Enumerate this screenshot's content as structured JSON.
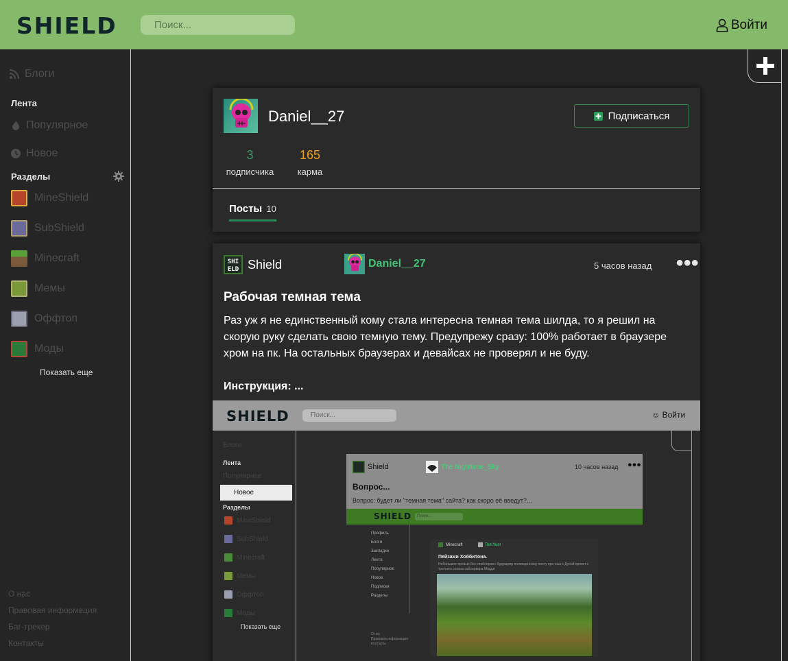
{
  "header": {
    "logo": "SHIELD",
    "search_placeholder": "Поиск...",
    "login_label": "Войти"
  },
  "sidebar": {
    "blogs": "Блоги",
    "feed_heading": "Лента",
    "popular": "Популярное",
    "new": "Новое",
    "sections_heading": "Разделы",
    "sections": [
      {
        "label": "MineShield",
        "color": "#b5442a"
      },
      {
        "label": "SubShield",
        "color": "#6a6a9a"
      },
      {
        "label": "Minecraft",
        "color": "#4a8a3a"
      },
      {
        "label": "Мемы",
        "color": "#7a9a3a"
      },
      {
        "label": "Оффтоп",
        "color": "#9aa0b0"
      },
      {
        "label": "Моды",
        "color": "#2a7a3a"
      }
    ],
    "show_more": "Показать еще",
    "footer": [
      "О нас",
      "Правовая информация",
      "Баг-трекер",
      "Контакты"
    ]
  },
  "profile": {
    "username": "Daniel__27",
    "subscribe_label": "Подписаться",
    "subscribers_count": "3",
    "subscribers_label": "подписчика",
    "karma_count": "165",
    "karma_label": "карма",
    "tab_label": "Посты",
    "tab_count": "10"
  },
  "post": {
    "source": "Shield",
    "author": "Daniel__27",
    "time": "5 часов назад",
    "title": "Рабочая темная тема",
    "body": "Раз уж я не единственный кому стала интересна темная тема шилда, то я решил на скорую руку сделать свою темную тему. Предупрежу сразу: 100% работает в браузере хром на пк. На остальных браузерах и девайсах не проверял и не буду.",
    "instruction": "Инструкция: ..."
  },
  "embedded": {
    "logo": "SHIELD",
    "search": "Поиск...",
    "login": "Войти",
    "blogs": "Блоги",
    "feed": "Лента",
    "popular": "Популярное",
    "new": "Новое",
    "sections_heading": "Разделы",
    "sections": [
      "MineShield",
      "SubShield",
      "Minecraft",
      "Мемы",
      "Оффтоп",
      "Моды"
    ],
    "show_more": "Показать еще",
    "post_source": "Shield",
    "post_author": "The Nighttime_Sky",
    "post_time": "10 часов назад",
    "post_title": "Вопрос...",
    "post_body": "Вопрос: будет ли \"темная тема\" сайта? как скоро её введут?...",
    "inner_logo": "SHIELD",
    "inner_search": "Поиск...",
    "inner_menu": [
      "Профиль",
      "Блоги",
      "Закладки",
      "Лента",
      "Популярное",
      "Новое",
      "Подписки",
      "Разделы"
    ],
    "inner_src": "Minecraft",
    "inner_author": "TomYum",
    "inner_title": "Пейзажи Хоббитона.",
    "inner_body": "Небольшое превью без спойлеров к будущему полноценному посту про наш с Духой проект с третьего сезона сабсервера Модди",
    "inner_footer": [
      "О нас",
      "Правовая информация",
      "Контакты"
    ]
  },
  "colors": {
    "header_bg": "#85ba6a",
    "page_bg": "#252525",
    "card_bg": "#2a2a2a",
    "subscribers_color": "#3c9a6a",
    "karma_color": "#f0a01e",
    "author_color": "#43c177",
    "accent_green": "#2f8a5a"
  }
}
